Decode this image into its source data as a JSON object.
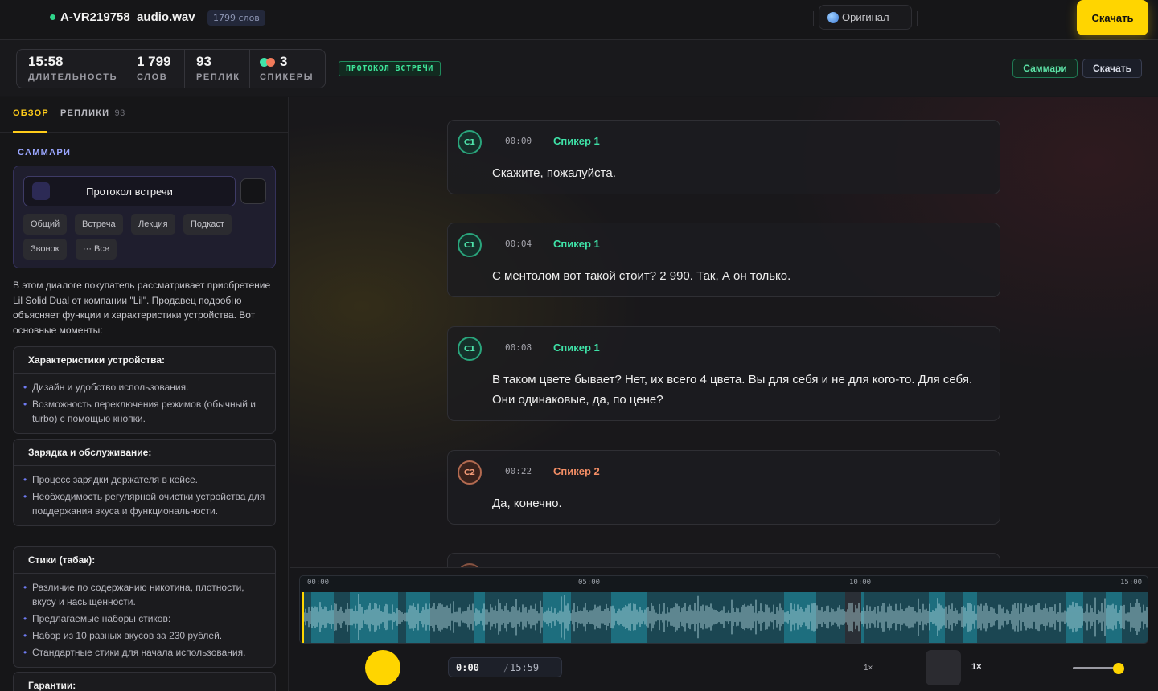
{
  "header": {
    "file_name": "A-VR219758_audio.wav",
    "word_badge": "1799 слов",
    "language_button": "Оригинал",
    "download_button": "Скачать"
  },
  "stats": {
    "duration": {
      "value": "15:58",
      "label": "ДЛИТЕЛЬНОСТЬ"
    },
    "words": {
      "value": "1 799",
      "label": "СЛОВ"
    },
    "replies": {
      "value": "93",
      "label": "РЕПЛИК"
    },
    "speakers": {
      "value": "3",
      "label": "СПИКЕРЫ"
    },
    "protocol_badge": "ПРОТОКОЛ ВСТРЕЧИ",
    "summary_button": "Саммари",
    "download_button": "Скачать"
  },
  "sidebar": {
    "tabs": {
      "overview": "ОБЗОР",
      "replies": "РЕПЛИКИ",
      "replies_count": "93"
    },
    "section_title": "САММАРИ",
    "preset_selected": "Протокол встречи",
    "presets": [
      "Общий",
      "Встреча",
      "Лекция",
      "Подкаст",
      "Звонок",
      "··· Все"
    ],
    "summary_intro": "В этом диалоге покупатель рассматривает приобретение Lil Solid Dual от компании \"Lil\". Продавец подробно объясняет функции и характеристики устройства. Вот основные моменты:",
    "topics": [
      {
        "title": "Характеристики устройства:",
        "items": [
          "Дизайн и удобство использования.",
          "Возможность переключения режимов (обычный и turbo) с помощью кнопки."
        ]
      },
      {
        "title": "Зарядка и обслуживание:",
        "items": [
          "Процесс зарядки держателя в кейсе.",
          "Необходимость регулярной очистки устройства для поддержания вкуса и функциональности."
        ]
      },
      {
        "title": "Стики (табак):",
        "items": [
          "Различие по содержанию никотина, плотности, вкусу и насыщенности.",
          "Предлагаемые наборы стиков:",
          "Набор из 10 разных вкусов за 230 рублей.",
          "Стандартные стики для начала использования."
        ]
      },
      {
        "title": "Гарантии:",
        "items": []
      }
    ]
  },
  "transcript": {
    "messages": [
      {
        "avatar": "C1",
        "time": "00:00",
        "speaker": "Спикер 1",
        "text": "Скажите, пожалуйста."
      },
      {
        "avatar": "C1",
        "time": "00:04",
        "speaker": "Спикер 1",
        "text": "С ментолом вот такой стоит? 2 990. Так, А он только."
      },
      {
        "avatar": "C1",
        "time": "00:08",
        "speaker": "Спикер 1",
        "text": "В таком цвете бывает? Нет, их всего 4 цвета. Вы для себя и не для кого-то. Для себя. Они одинаковые, да, по цене?"
      },
      {
        "avatar": "C2",
        "time": "00:22",
        "speaker": "Спикер 2",
        "text": "Да, конечно."
      }
    ]
  },
  "player": {
    "ticks": [
      "00:00",
      "05:00",
      "10:00",
      "15:00"
    ],
    "current_time": "0:00",
    "separator": "/",
    "total_time": "15:59",
    "speed_small": "1×",
    "speed": "1×",
    "volume": 0.95,
    "progress": 0.0
  },
  "colors": {
    "accent": "#ffd500",
    "speaker1": "#3fe3a8",
    "speaker2": "#f38e65",
    "speaker3": "#f07a5a",
    "waveform_bg": "#1b4652",
    "waveform_wave": "#b9dde4"
  }
}
